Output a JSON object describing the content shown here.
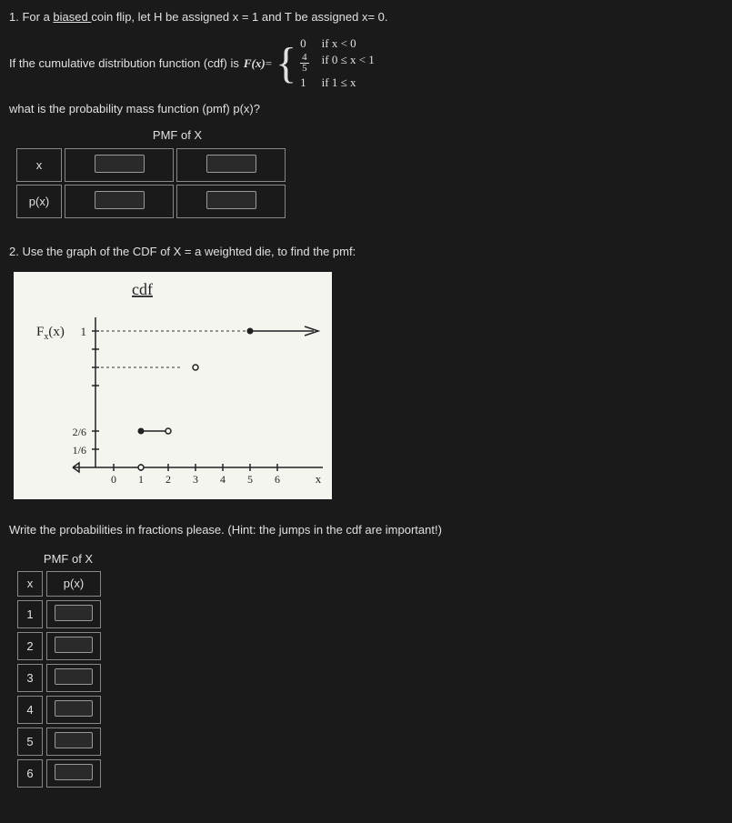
{
  "q1": {
    "intro_pre": "1. For a ",
    "intro_biased": "biased ",
    "intro_post": "coin flip, let H be assigned x = 1 and T be assigned x= 0.",
    "cdf_prefix": "If the cumulative distribution function (cdf) is ",
    "F_label": "F(x)",
    "equals": " = ",
    "piecewise": {
      "v1": "0",
      "c1": "if   x < 0",
      "v2_num": "4",
      "v2_den": "5",
      "c2": "if   0 ≤ x < 1",
      "v3": "1",
      "c3": "if   1 ≤ x"
    },
    "pmf_question": "what is the probability mass function (pmf) p(x)?",
    "table_title": "PMF of X",
    "row_x": "x",
    "row_px": "p(x)"
  },
  "q2": {
    "intro": "2. Use the graph of the CDF of X = a weighted die,  to find the pmf:",
    "graph": {
      "title": "cdf",
      "ylabel": "F(x)",
      "y_ticks": [
        "1",
        "2/6",
        "1/6"
      ],
      "x_ticks": [
        "0",
        "1",
        "2",
        "3",
        "4",
        "5",
        "6"
      ],
      "x_end": "x",
      "sub_x": "x"
    },
    "hint": "Write the probabilities in fractions please. (Hint: the jumps in the cdf are important!)",
    "table_title": "PMF of X",
    "hdr_x": "x",
    "hdr_px": "p(x)",
    "rows": [
      "1",
      "2",
      "3",
      "4",
      "5",
      "6"
    ]
  }
}
